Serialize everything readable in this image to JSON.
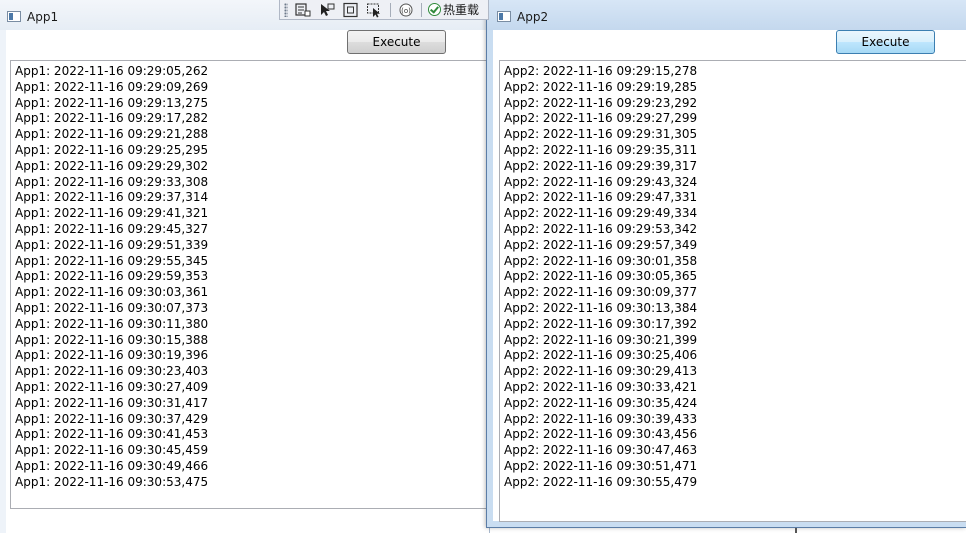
{
  "app1": {
    "title": "App1",
    "execute_label": "Execute",
    "log_lines": [
      "App1: 2022-11-16 09:29:05,262",
      "App1: 2022-11-16 09:29:09,269",
      "App1: 2022-11-16 09:29:13,275",
      "App1: 2022-11-16 09:29:17,282",
      "App1: 2022-11-16 09:29:21,288",
      "App1: 2022-11-16 09:29:25,295",
      "App1: 2022-11-16 09:29:29,302",
      "App1: 2022-11-16 09:29:33,308",
      "App1: 2022-11-16 09:29:37,314",
      "App1: 2022-11-16 09:29:41,321",
      "App1: 2022-11-16 09:29:45,327",
      "App1: 2022-11-16 09:29:51,339",
      "App1: 2022-11-16 09:29:55,345",
      "App1: 2022-11-16 09:29:59,353",
      "App1: 2022-11-16 09:30:03,361",
      "App1: 2022-11-16 09:30:07,373",
      "App1: 2022-11-16 09:30:11,380",
      "App1: 2022-11-16 09:30:15,388",
      "App1: 2022-11-16 09:30:19,396",
      "App1: 2022-11-16 09:30:23,403",
      "App1: 2022-11-16 09:30:27,409",
      "App1: 2022-11-16 09:30:31,417",
      "App1: 2022-11-16 09:30:37,429",
      "App1: 2022-11-16 09:30:41,453",
      "App1: 2022-11-16 09:30:45,459",
      "App1: 2022-11-16 09:30:49,466",
      "App1: 2022-11-16 09:30:53,475"
    ]
  },
  "app2": {
    "title": "App2",
    "execute_label": "Execute",
    "log_lines": [
      "App2: 2022-11-16 09:29:15,278",
      "App2: 2022-11-16 09:29:19,285",
      "App2: 2022-11-16 09:29:23,292",
      "App2: 2022-11-16 09:29:27,299",
      "App2: 2022-11-16 09:29:31,305",
      "App2: 2022-11-16 09:29:35,311",
      "App2: 2022-11-16 09:29:39,317",
      "App2: 2022-11-16 09:29:43,324",
      "App2: 2022-11-16 09:29:47,331",
      "App2: 2022-11-16 09:29:49,334",
      "App2: 2022-11-16 09:29:53,342",
      "App2: 2022-11-16 09:29:57,349",
      "App2: 2022-11-16 09:30:01,358",
      "App2: 2022-11-16 09:30:05,365",
      "App2: 2022-11-16 09:30:09,377",
      "App2: 2022-11-16 09:30:13,384",
      "App2: 2022-11-16 09:30:17,392",
      "App2: 2022-11-16 09:30:21,399",
      "App2: 2022-11-16 09:30:25,406",
      "App2: 2022-11-16 09:30:29,413",
      "App2: 2022-11-16 09:30:33,421",
      "App2: 2022-11-16 09:30:35,424",
      "App2: 2022-11-16 09:30:39,433",
      "App2: 2022-11-16 09:30:43,456",
      "App2: 2022-11-16 09:30:47,463",
      "App2: 2022-11-16 09:30:51,471",
      "App2: 2022-11-16 09:30:55,479"
    ]
  },
  "debug_toolbar": {
    "hot_reload_label": "热重载",
    "icons": [
      "toolbar-grip",
      "live-visual-tree-icon",
      "select-element-icon",
      "display-layout-adorners-icon",
      "track-focus-icon",
      "binding-failures-icon",
      "hot-reload-check-icon"
    ],
    "hot_reload_color": "#2f8a3a"
  }
}
